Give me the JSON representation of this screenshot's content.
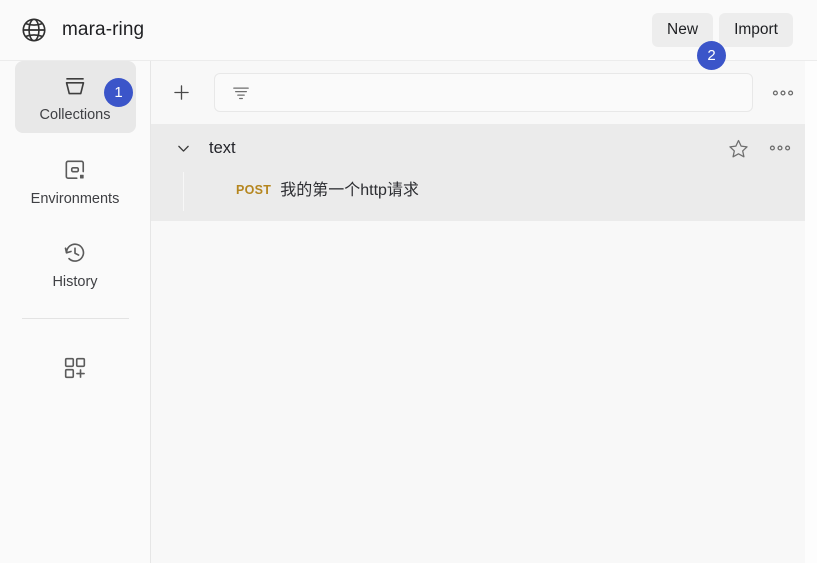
{
  "header": {
    "logo_icon": "globe-icon",
    "title": "mara-ring",
    "buttons": [
      {
        "label": "New",
        "name": "new-button"
      },
      {
        "label": "Import",
        "name": "import-button"
      }
    ]
  },
  "badges": [
    {
      "label": "1",
      "target": "collections-rail-item",
      "color": "#3b55c9"
    },
    {
      "label": "2",
      "target": "import-button",
      "color": "#3b55c9"
    }
  ],
  "sidebar": {
    "items": [
      {
        "label": "Collections",
        "icon": "collections-icon",
        "active": true
      },
      {
        "label": "Environments",
        "icon": "environments-icon",
        "active": false
      },
      {
        "label": "History",
        "icon": "history-clock-icon",
        "active": false
      },
      {
        "label": "",
        "icon": "add-apps-grid-icon",
        "active": false
      }
    ]
  },
  "toolbar": {
    "add_icon": "plus-icon",
    "filter_icon": "filter-lines-icon",
    "search_value": "",
    "search_placeholder": "",
    "more_icon": "three-dots-icon"
  },
  "collections": [
    {
      "name": "text",
      "expanded": true,
      "chevron_icon": "chevron-down-icon",
      "star_icon": "star-outline-icon",
      "more_icon": "three-dots-icon",
      "requests": [
        {
          "method": "POST",
          "name": "我的第一个http请求",
          "method_color": "#b5861f"
        }
      ]
    }
  ],
  "colors": {
    "accent_blue": "#3b55c9",
    "collection_bg": "#ebebeb",
    "panel_bg": "#f8f8f8",
    "rail_bg": "#fafafa",
    "method_post": "#b5861f"
  }
}
